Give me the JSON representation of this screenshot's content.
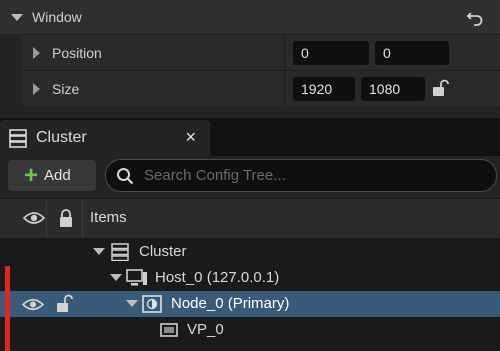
{
  "window_section": {
    "title": "Window",
    "properties": [
      {
        "label": "Position",
        "values": [
          "0",
          "0"
        ]
      },
      {
        "label": "Size",
        "values": [
          "1920",
          "1080"
        ]
      }
    ]
  },
  "cluster_tab": {
    "title": "Cluster",
    "close_glyph": "×"
  },
  "toolbar": {
    "add_label": "Add",
    "add_glyph": "+",
    "search_placeholder": "Search Config Tree...",
    "search_value": ""
  },
  "columns": {
    "items_label": "Items"
  },
  "tree": [
    {
      "label": "Cluster",
      "icon": "cluster-icon",
      "depth": 0,
      "expanded": true,
      "selected": false
    },
    {
      "label": "Host_0 (127.0.0.1)",
      "icon": "host-icon",
      "depth": 1,
      "expanded": true,
      "selected": false
    },
    {
      "label": "Node_0 (Primary)",
      "icon": "node-icon",
      "depth": 2,
      "expanded": true,
      "selected": true
    },
    {
      "label": "VP_0",
      "icon": "viewport-icon",
      "depth": 3,
      "expanded": false,
      "selected": false
    }
  ],
  "colors": {
    "accent_selection": "#3a5a7a",
    "add_green": "#70c64a",
    "highlight_red": "#e1261c"
  }
}
